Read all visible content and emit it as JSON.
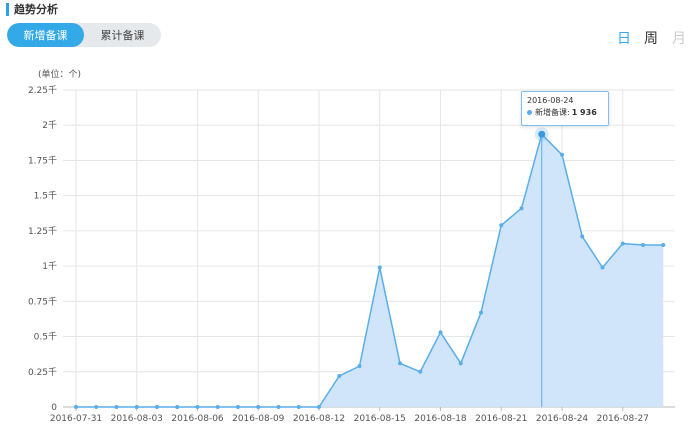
{
  "header": {
    "title": "趋势分析"
  },
  "tabs": [
    {
      "label": "新增备课",
      "active": true
    },
    {
      "label": "累计备课",
      "active": false
    }
  ],
  "period_options": [
    {
      "label": "日",
      "active": true
    },
    {
      "label": "周",
      "active": false
    },
    {
      "label": "月",
      "active": false,
      "disabled": true
    }
  ],
  "colors": {
    "accent": "#34a9e8",
    "series_line": "#5aaee8",
    "series_fill": "#cde4fa"
  },
  "tooltip": {
    "date": "2016-08-24",
    "series": "新增备课:",
    "value": "1 936"
  },
  "chart_data": {
    "type": "area",
    "ylabel": "(单位：个)",
    "yticks": [
      "0",
      "0.25千",
      "0.5千",
      "0.75千",
      "1千",
      "1.25千",
      "1.5千",
      "1.75千",
      "2千",
      "2.25千"
    ],
    "ylim": [
      0,
      2250
    ],
    "xtick_labels": [
      "2016-07-31",
      "2016-08-03",
      "2016-08-06",
      "2016-08-09",
      "2016-08-12",
      "2016-08-15",
      "2016-08-18",
      "2016-08-21",
      "2016-08-24",
      "2016-08-27"
    ],
    "x": [
      "2016-07-31",
      "2016-08-01",
      "2016-08-02",
      "2016-08-03",
      "2016-08-04",
      "2016-08-05",
      "2016-08-06",
      "2016-08-07",
      "2016-08-08",
      "2016-08-09",
      "2016-08-10",
      "2016-08-11",
      "2016-08-12",
      "2016-08-13",
      "2016-08-14",
      "2016-08-15",
      "2016-08-16",
      "2016-08-17",
      "2016-08-18",
      "2016-08-19",
      "2016-08-20",
      "2016-08-21",
      "2016-08-22",
      "2016-08-23",
      "2016-08-24",
      "2016-08-25",
      "2016-08-26",
      "2016-08-27",
      "2016-08-28",
      "2016-08-29"
    ],
    "series": [
      {
        "name": "新增备课",
        "values": [
          0,
          0,
          0,
          0,
          0,
          0,
          0,
          0,
          0,
          0,
          0,
          0,
          0,
          220,
          290,
          990,
          310,
          250,
          530,
          310,
          670,
          1290,
          1410,
          1936,
          1790,
          1210,
          990,
          1160,
          1150,
          1150
        ]
      }
    ],
    "highlight_index": 23,
    "grid": true
  }
}
